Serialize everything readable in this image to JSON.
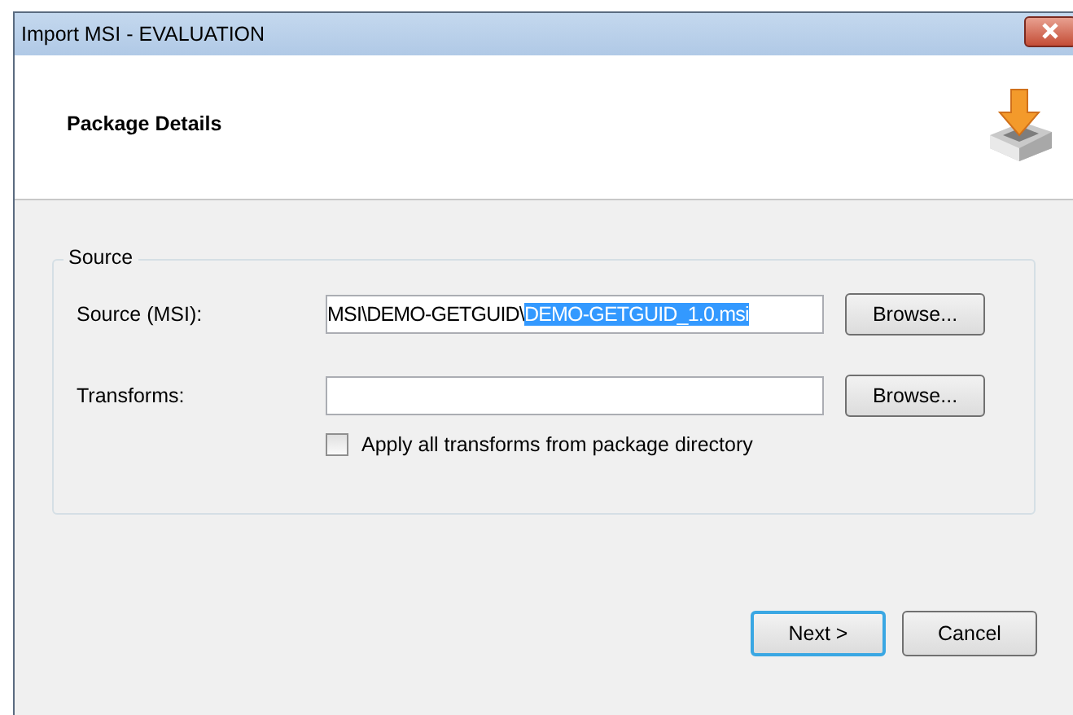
{
  "window": {
    "title": "Import MSI - EVALUATION"
  },
  "header": {
    "title": "Package Details"
  },
  "group": {
    "title": "Source",
    "source": {
      "label": "Source (MSI):",
      "text": "MSI\\DEMO-GETGUID\\",
      "selected_text": "DEMO-GETGUID_1.0.msi",
      "button": "Browse..."
    },
    "transforms": {
      "label": "Transforms:",
      "button": "Browse..."
    },
    "apply_all": {
      "label": "Apply all transforms from package directory",
      "checked": false
    }
  },
  "buttons": [
    {
      "label": "Next >",
      "default": true
    },
    {
      "label": "Cancel",
      "default": false
    }
  ]
}
